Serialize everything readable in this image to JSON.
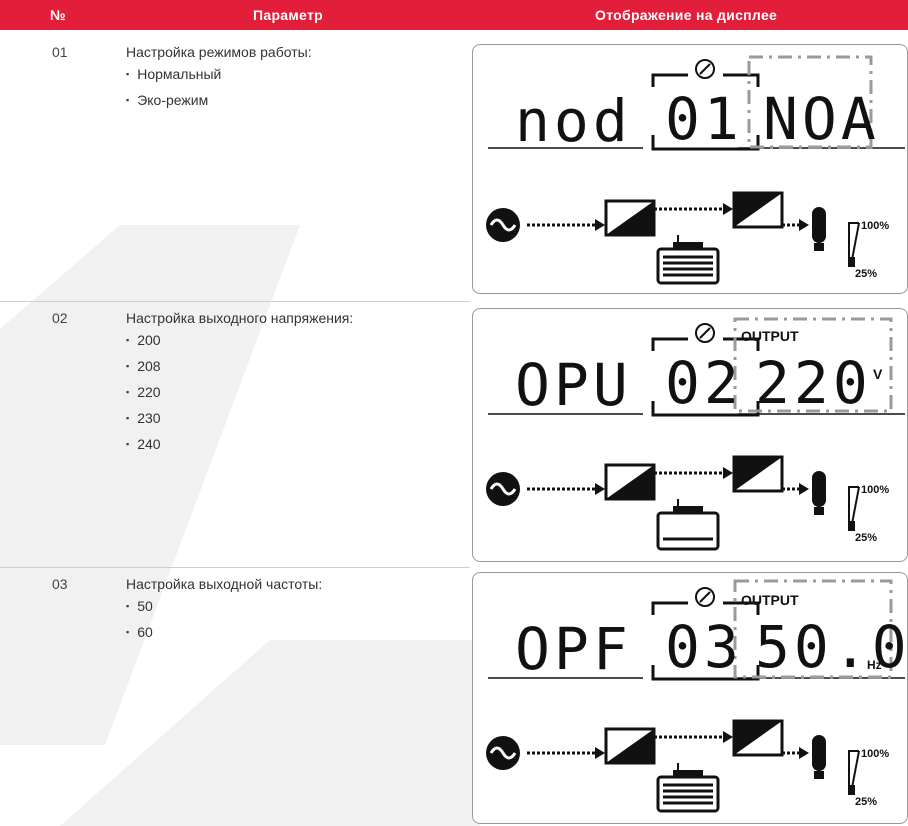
{
  "header": {
    "col_no": "№",
    "col_param": "Параметр",
    "col_display": "Отображение на дисплее"
  },
  "rows": [
    {
      "no": "01",
      "title": "Настройка режимов работы:",
      "items": [
        "Нормальный",
        "Эко-режим"
      ],
      "lcd": {
        "code": "nod",
        "num": "01",
        "value": "NOA",
        "output_label": "",
        "unit": "",
        "battery": "full"
      }
    },
    {
      "no": "02",
      "title": "Настройка выходного напряжения:",
      "items": [
        "200",
        "208",
        "220",
        "230",
        "240"
      ],
      "lcd": {
        "code": "OPU",
        "num": "02",
        "value": "220",
        "output_label": "OUTPUT",
        "unit": "V",
        "battery": "empty"
      }
    },
    {
      "no": "03",
      "title": "Настройка выходной частоты:",
      "items": [
        "50",
        "60"
      ],
      "lcd": {
        "code": "OPF",
        "num": "03",
        "value": "50.0",
        "output_label": "OUTPUT",
        "unit": "Hz",
        "battery": "full"
      }
    }
  ],
  "load_labels": {
    "high": "100%",
    "low": "25%"
  },
  "colors": {
    "header": "#e31e3a",
    "lcd_ink": "#111111",
    "dash": "#9a9a9a"
  }
}
